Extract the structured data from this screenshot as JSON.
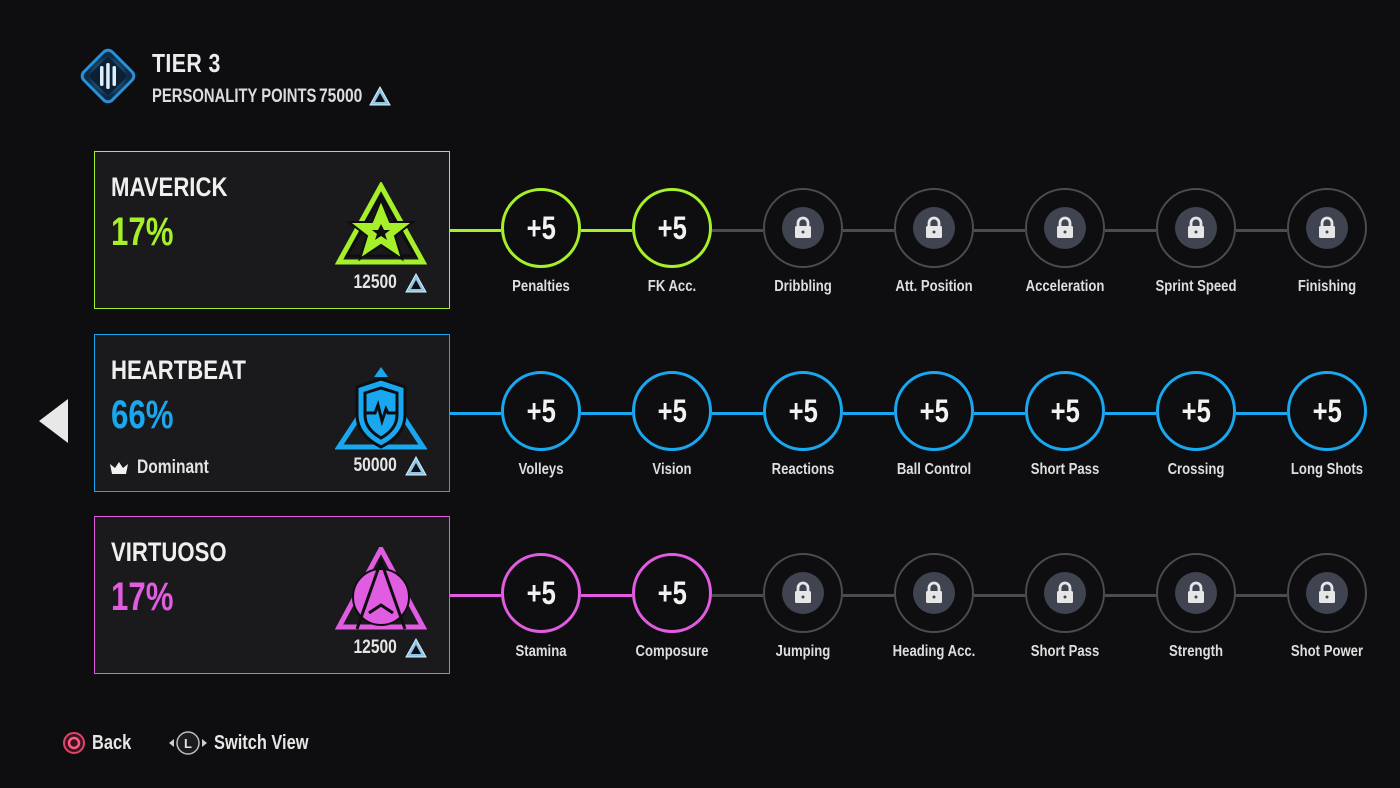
{
  "header": {
    "tier_title": "TIER 3",
    "personality_points_label": "PERSONALITY POINTS",
    "personality_points_value": "75000",
    "currency_icon": "triangle-points-icon"
  },
  "colors": {
    "maverick": "#a6f02a",
    "heartbeat": "#19a8f0",
    "virtuoso": "#e05ce0",
    "locked": "#4b4b50",
    "background": "#0e0e10"
  },
  "rows": [
    {
      "key": "maverick",
      "name": "MAVERICK",
      "percent": "17%",
      "cost": "12500",
      "badge_icon": "star-triangle-icon",
      "dominant": null,
      "nodes": [
        {
          "label": "Penalties",
          "value": "+5",
          "state": "unlocked"
        },
        {
          "label": "FK Acc.",
          "value": "+5",
          "state": "unlocked"
        },
        {
          "label": "Dribbling",
          "value": "",
          "state": "locked"
        },
        {
          "label": "Att. Position",
          "value": "",
          "state": "locked"
        },
        {
          "label": "Acceleration",
          "value": "",
          "state": "locked"
        },
        {
          "label": "Sprint Speed",
          "value": "",
          "state": "locked"
        },
        {
          "label": "Finishing",
          "value": "",
          "state": "locked"
        }
      ]
    },
    {
      "key": "heartbeat",
      "name": "HEARTBEAT",
      "percent": "66%",
      "cost": "50000",
      "badge_icon": "shield-heartbeat-icon",
      "dominant": "Dominant",
      "nodes": [
        {
          "label": "Volleys",
          "value": "+5",
          "state": "unlocked"
        },
        {
          "label": "Vision",
          "value": "+5",
          "state": "unlocked"
        },
        {
          "label": "Reactions",
          "value": "+5",
          "state": "unlocked"
        },
        {
          "label": "Ball Control",
          "value": "+5",
          "state": "unlocked"
        },
        {
          "label": "Short Pass",
          "value": "+5",
          "state": "unlocked"
        },
        {
          "label": "Crossing",
          "value": "+5",
          "state": "unlocked"
        },
        {
          "label": "Long Shots",
          "value": "+5",
          "state": "unlocked"
        }
      ]
    },
    {
      "key": "virtuoso",
      "name": "VIRTUOSO",
      "percent": "17%",
      "cost": "12500",
      "badge_icon": "virtuoso-a-icon",
      "dominant": null,
      "nodes": [
        {
          "label": "Stamina",
          "value": "+5",
          "state": "unlocked"
        },
        {
          "label": "Composure",
          "value": "+5",
          "state": "unlocked"
        },
        {
          "label": "Jumping",
          "value": "",
          "state": "locked"
        },
        {
          "label": "Heading Acc.",
          "value": "",
          "state": "locked"
        },
        {
          "label": "Short Pass",
          "value": "",
          "state": "locked"
        },
        {
          "label": "Strength",
          "value": "",
          "state": "locked"
        },
        {
          "label": "Shot Power",
          "value": "",
          "state": "locked"
        }
      ]
    }
  ],
  "footer": {
    "back_label": "Back",
    "switch_view_label": "Switch View",
    "l_button_glyph": "L"
  }
}
